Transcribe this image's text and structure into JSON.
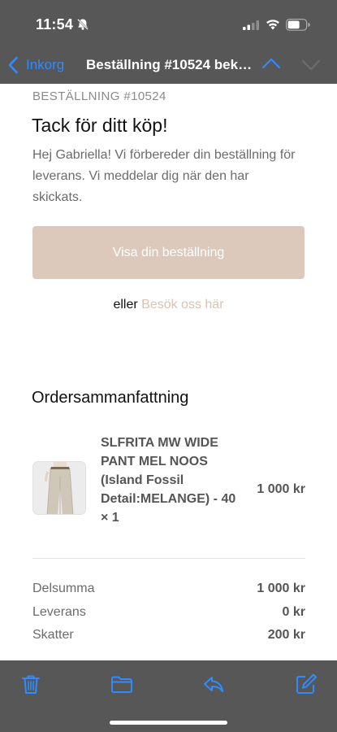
{
  "status_bar": {
    "time": "11:54"
  },
  "nav": {
    "back_label": "Inkorg",
    "title": "Beställning #10524 bekräftad"
  },
  "email": {
    "order_number": "BESTÄLLNING #10524",
    "heading": "Tack för ditt köp!",
    "intro": "Hej Gabriella! Vi förbereder din beställning för leverans. Vi meddelar dig när den har skickats.",
    "button_label": "Visa din beställning",
    "or_text": "eller",
    "visit_link": "Besök oss här",
    "summary_heading": "Ordersammanfattning",
    "product": {
      "name": "SLFRITA MW WIDE PANT MEL NOOS (Island Fossil Detail:MELANGE) - 40 × 1",
      "price": "1 000 kr",
      "image": "beige-wide-pants"
    },
    "totals": [
      {
        "label": "Delsumma",
        "value": "1 000 kr"
      },
      {
        "label": "Leverans",
        "value": "0 kr"
      },
      {
        "label": "Skatter",
        "value": "200 kr"
      }
    ]
  },
  "colors": {
    "chrome": "#575757",
    "accent": "#2f8bff",
    "button": "#dcc9bb",
    "link": "#d6c3b4"
  },
  "toolbar": {
    "icons": [
      "trash-icon",
      "folder-icon",
      "reply-icon",
      "compose-icon"
    ]
  }
}
